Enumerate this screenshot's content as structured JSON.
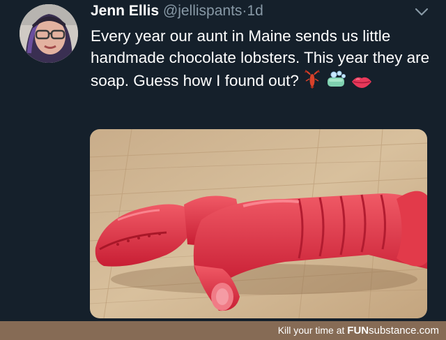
{
  "tweet": {
    "author_name": "Jenn Ellis",
    "handle": "@jellispants",
    "separator": "·",
    "time": "1d",
    "text": "Every year our aunt in Maine sends us little handmade chocolate lobsters. This year they are soap. Guess how I found out?",
    "emojis": [
      "lobster-emoji",
      "soap-emoji",
      "lips-emoji"
    ]
  },
  "footer": {
    "prefix": "Kill your time at ",
    "brand_bold": "FUN",
    "brand_rest": "substance.com"
  },
  "colors": {
    "background": "#15202b",
    "name": "#ffffff",
    "secondary": "#8899a6",
    "footer_bg": "#866b55",
    "lobster": "#e8384a"
  }
}
